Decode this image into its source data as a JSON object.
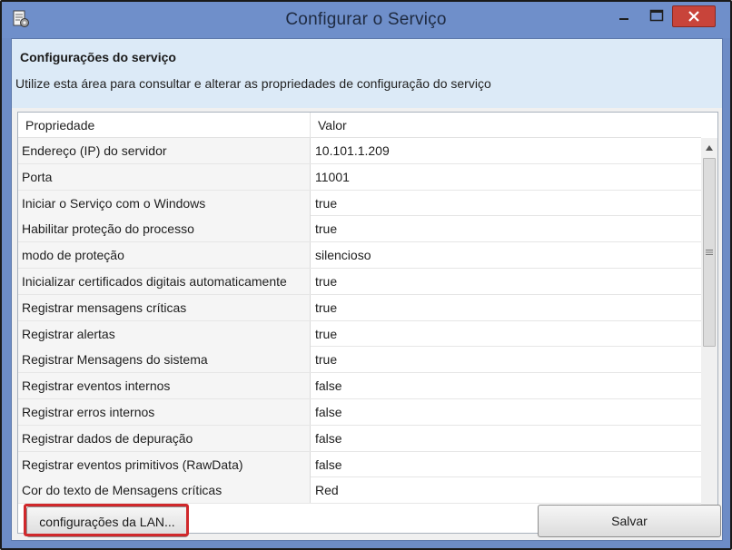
{
  "window": {
    "title": "Configurar o Serviço",
    "icon": "service-settings-icon"
  },
  "header": {
    "title": "Configurações do serviço",
    "description": "Utilize esta área para consultar e alterar as propriedades de configuração do serviço"
  },
  "grid": {
    "columns": [
      "Propriedade",
      "Valor"
    ],
    "rows": [
      {
        "property": "Endereço (IP) do servidor",
        "value": "10.101.1.209"
      },
      {
        "property": "Porta",
        "value": "11001"
      },
      {
        "property": "Iniciar o Serviço com o Windows",
        "value": "true"
      },
      {
        "property": "Habilitar proteção do processo",
        "value": "true"
      },
      {
        "property": "modo de proteção",
        "value": "silencioso"
      },
      {
        "property": "Inicializar certificados digitais automaticamente",
        "value": "true"
      },
      {
        "property": "Registrar mensagens críticas",
        "value": "true"
      },
      {
        "property": "Registrar alertas",
        "value": "true"
      },
      {
        "property": "Registrar Mensagens do sistema",
        "value": "true"
      },
      {
        "property": "Registrar eventos internos",
        "value": "false"
      },
      {
        "property": "Registrar erros internos",
        "value": "false"
      },
      {
        "property": "Registrar dados de depuração",
        "value": "false"
      },
      {
        "property": "Registrar eventos primitivos (RawData)",
        "value": "false"
      },
      {
        "property": "Cor do texto de Mensagens críticas",
        "value": "Red"
      }
    ]
  },
  "buttons": {
    "lan_label": "configurações da LAN...",
    "save_label": "Salvar"
  },
  "colors": {
    "titlebar": "#6f8fca",
    "header_panel": "#dceaf7",
    "close_button": "#c8443a",
    "highlight": "#d0282b"
  }
}
